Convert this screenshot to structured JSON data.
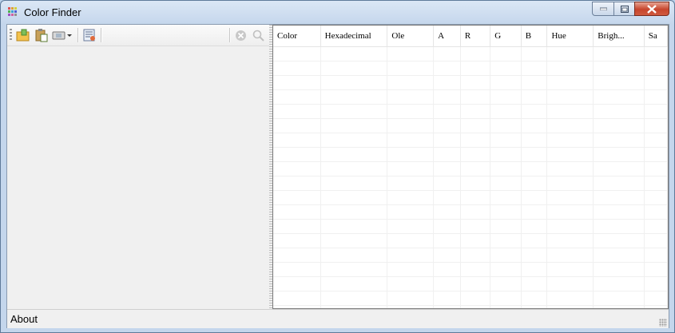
{
  "window": {
    "title": "Color Finder"
  },
  "titlebar": {
    "min_icon": "minimize-icon",
    "max_icon": "maximize-icon",
    "close_icon": "close-icon"
  },
  "toolbar": {
    "buttons": [
      {
        "name": "open-folder-icon"
      },
      {
        "name": "paste-icon"
      },
      {
        "name": "capture-dropdown-icon"
      },
      {
        "name": "settings-list-icon"
      },
      {
        "name": "clear-icon"
      },
      {
        "name": "zoom-icon"
      }
    ]
  },
  "grid": {
    "columns": [
      "Color",
      "Hexadecimal",
      "Ole",
      "A",
      "R",
      "G",
      "B",
      "Hue",
      "Brigh...",
      "Sa"
    ],
    "rows": []
  },
  "status": {
    "about_label": "About"
  }
}
